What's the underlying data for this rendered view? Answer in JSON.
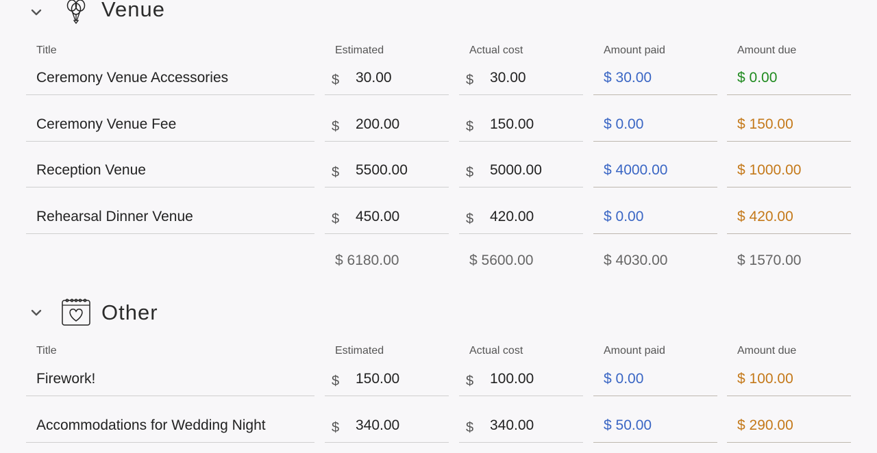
{
  "labels": {
    "title": "Title",
    "estimated": "Estimated",
    "actual": "Actual cost",
    "paid": "Amount paid",
    "due": "Amount due",
    "currency": "$"
  },
  "sections": [
    {
      "name": "Venue",
      "icon": "balloons-icon",
      "rows": [
        {
          "title": "Ceremony Venue Accessories",
          "estimated": "30.00",
          "actual": "30.00",
          "paid": "$ 30.00",
          "due": "$ 0.00",
          "due_status": "green"
        },
        {
          "title": "Ceremony Venue Fee",
          "estimated": "200.00",
          "actual": "150.00",
          "paid": "$ 0.00",
          "due": "$ 150.00",
          "due_status": "orange"
        },
        {
          "title": "Reception Venue",
          "estimated": "5500.00",
          "actual": "5000.00",
          "paid": "$ 4000.00",
          "due": "$ 1000.00",
          "due_status": "orange"
        },
        {
          "title": "Rehearsal Dinner Venue",
          "estimated": "450.00",
          "actual": "420.00",
          "paid": "$ 0.00",
          "due": "$ 420.00",
          "due_status": "orange"
        }
      ],
      "totals": {
        "estimated": "$ 6180.00",
        "actual": "$ 5600.00",
        "paid": "$ 4030.00",
        "due": "$ 1570.00"
      }
    },
    {
      "name": "Other",
      "icon": "calendar-heart-icon",
      "rows": [
        {
          "title": "Firework!",
          "estimated": "150.00",
          "actual": "100.00",
          "paid": "$ 0.00",
          "due": "$ 100.00",
          "due_status": "orange"
        },
        {
          "title": "Accommodations for Wedding Night",
          "estimated": "340.00",
          "actual": "340.00",
          "paid": "$ 50.00",
          "due": "$ 290.00",
          "due_status": "orange"
        }
      ]
    }
  ],
  "colors": {
    "paid": "#3a66c4",
    "due_ok": "#1f8a1f",
    "due_pending": "#c4791a"
  }
}
